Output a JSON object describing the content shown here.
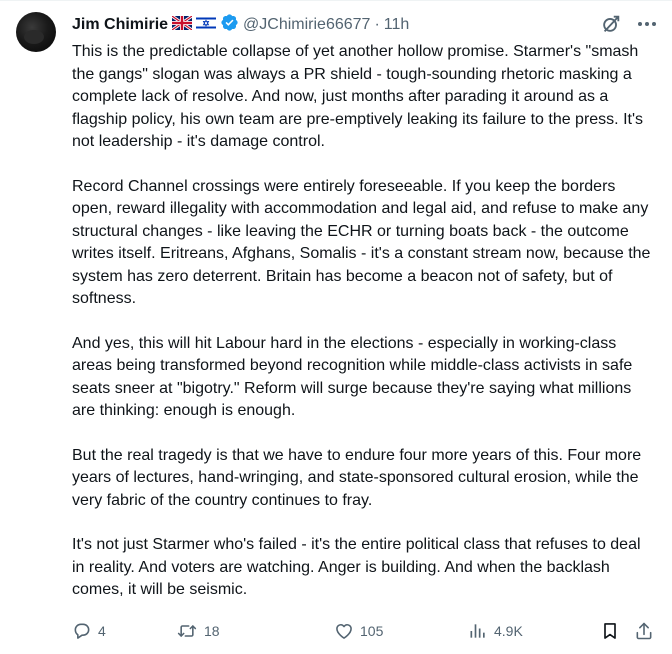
{
  "author": {
    "name": "Jim Chimirie",
    "handle": "@JChimirie66677",
    "time": "11h",
    "flags": [
      "uk-flag-icon",
      "israel-flag-icon"
    ],
    "verified": true,
    "verified_color": "#1d9bf0"
  },
  "tweet": {
    "paragraphs": [
      "This is the predictable collapse of yet another hollow promise. Starmer's \"smash the gangs\" slogan was always a PR shield - tough-sounding rhetoric masking a complete lack of resolve. And now, just months after parading it around as a flagship policy, his own team are pre-emptively leaking its failure to the press. It's not leadership - it's damage control.",
      "Record Channel crossings were entirely foreseeable. If you keep the borders open, reward illegality with accommodation and legal aid, and refuse to make any structural changes - like leaving the ECHR or turning boats back - the outcome writes itself. Eritreans, Afghans, Somalis - it's a constant stream now, because the system has zero deterrent. Britain has become a beacon not of safety, but of softness.",
      "And yes, this will hit Labour hard in the elections - especially in working-class areas being transformed beyond recognition while middle-class activists in safe seats sneer at \"bigotry.\" Reform will surge because they're saying what millions are thinking: enough is enough.",
      "But the real tragedy is that we have to endure four more years of this. Four more years of lectures, hand-wringing, and state-sponsored cultural erosion, while the very fabric of the country continues to fray.",
      "It's not just Starmer who's failed - it's the entire political class that refuses to deal in reality. And voters are watching. Anger is building. And when the backlash comes, it will be seismic."
    ]
  },
  "stats": {
    "replies": "4",
    "retweets": "18",
    "likes": "105",
    "views": "4.9K"
  },
  "colors": {
    "text": "#0f1419",
    "muted": "#536471",
    "accent": "#1d9bf0"
  }
}
